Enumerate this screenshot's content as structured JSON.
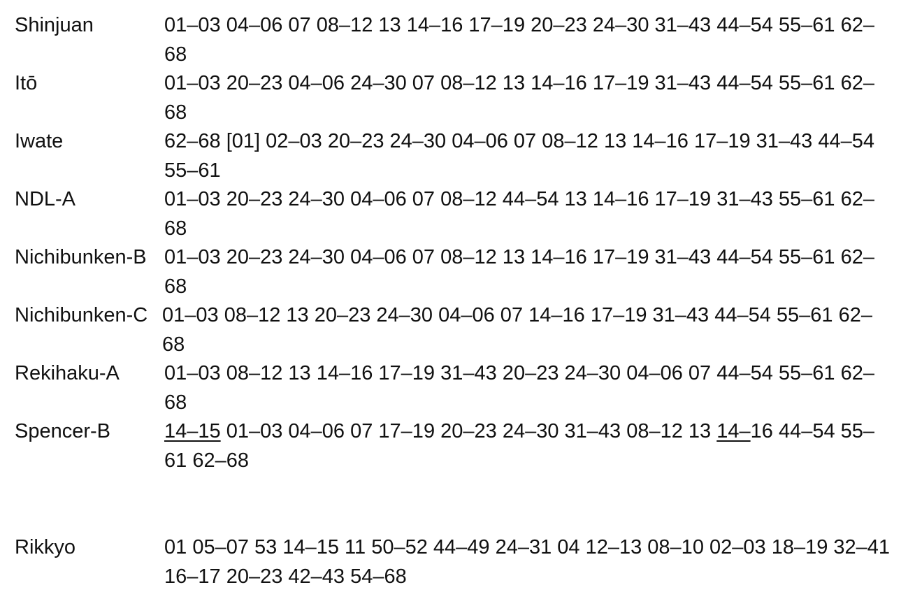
{
  "entries": [
    {
      "label": "Shinjuan",
      "sequence": "01–03 04–06 07 08–12 13 14–16 17–19 20–23 24–30 31–43 44–54 55–61 62–68"
    },
    {
      "label": "Itō",
      "sequence": "01–03 20–23 04–06 24–30 07 08–12 13 14–16 17–19 31–43 44–54 55–61 62–68"
    },
    {
      "label": "Iwate",
      "sequence": "62–68 [01] 02–03 20–23 24–30 04–06 07 08–12 13 14–16 17–19 31–43 44–54 55–61"
    },
    {
      "label": "NDL-A",
      "sequence": "01–03 20–23 24–30 04–06 07 08–12 44–54 13 14–16 17–19 31–43 55–61 62–68"
    },
    {
      "label": "Nichibunken-B",
      "sequence": "01–03 20–23 24–30 04–06 07 08–12 13 14–16 17–19 31–43 44–54 55–61 62–68"
    },
    {
      "label": "Nichibunken-C",
      "sequence": "01–03 08–12 13 20–23 24–30 04–06 07 14–16 17–19 31–43 44–54 55–61 62–68"
    },
    {
      "label": "Rekihaku-A",
      "sequence": "01–03 08–12 13 14–16 17–19 31–43 20–23 24–30 04–06 07 44–54 55–61 62–68"
    },
    {
      "label": "Spencer-B",
      "sequence_underlined_start": "14–15",
      "sequence_mid": " 01–03 04–06 07 17–19 20–23 24–30 31–43 08–12 13 ",
      "sequence_underlined_mid": "14–",
      "sequence_end": "16 44–54 55–61 62–68"
    },
    {
      "label": "Rikkyo",
      "sequence": "01 05–07 53 14–15 11 50–52 44–49 24–31 04 12–13 08–10 02–03 18–19 32–41 16–17 20–23 42–43 54–68"
    }
  ]
}
